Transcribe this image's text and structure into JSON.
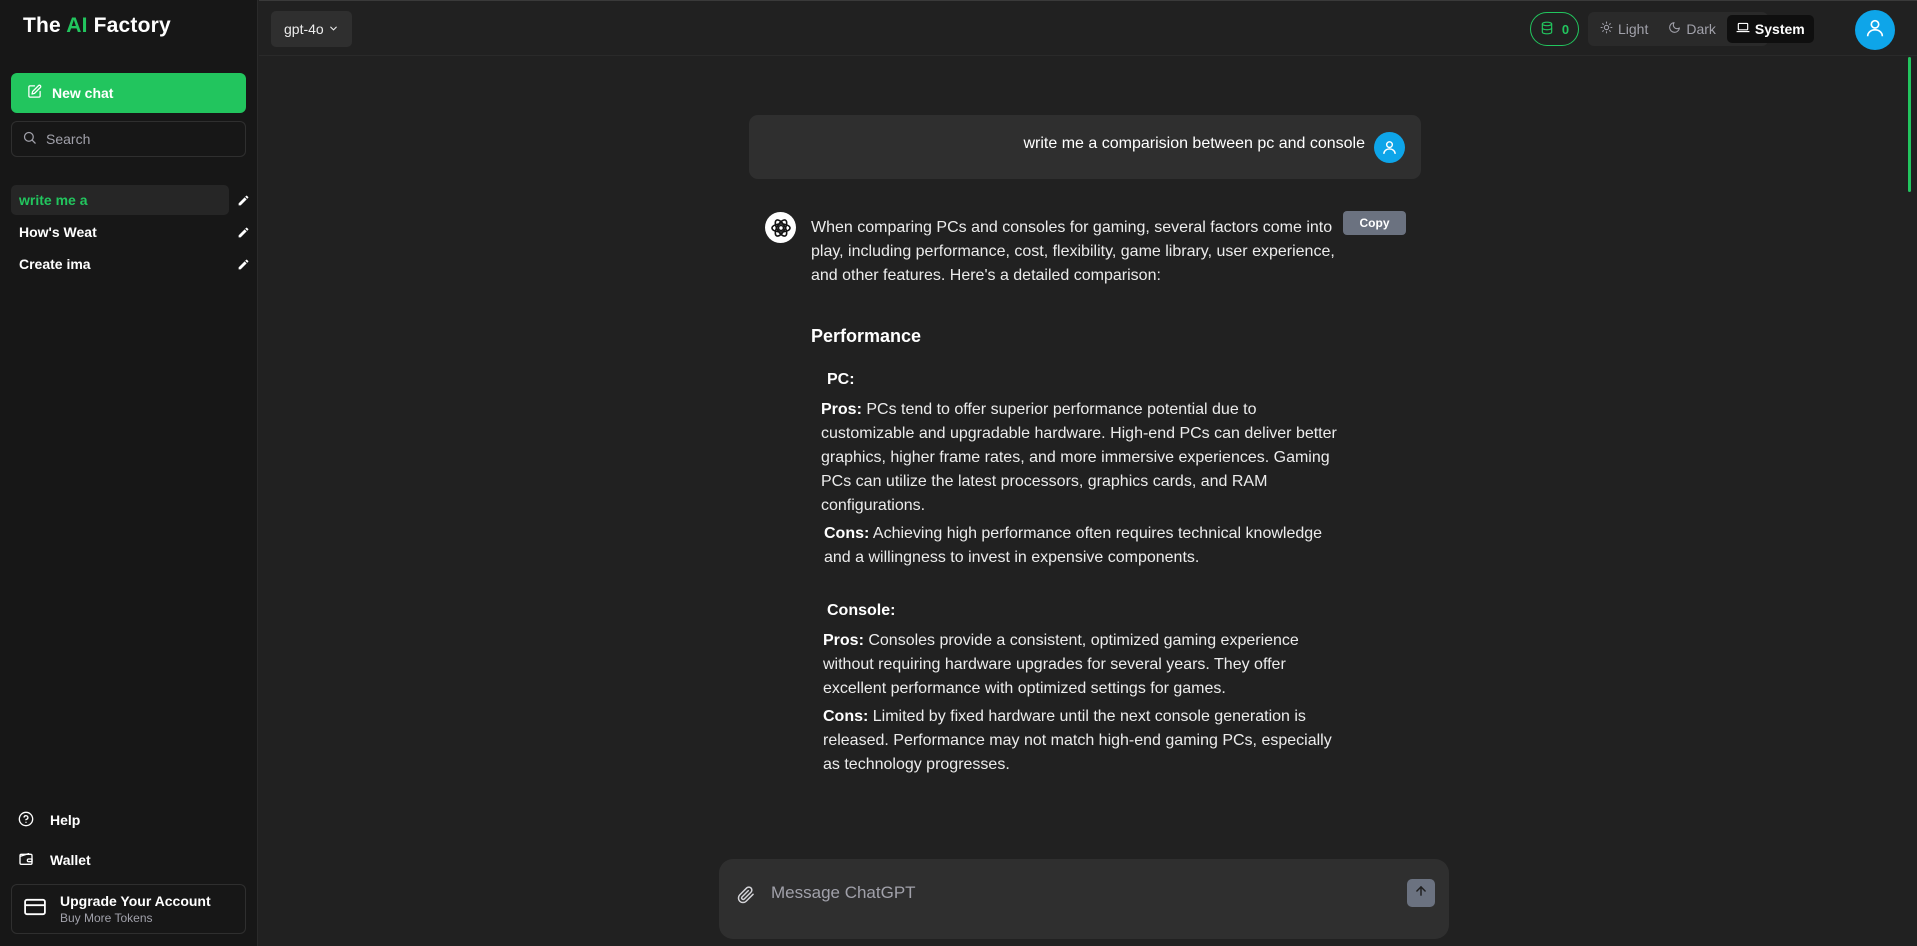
{
  "brand": {
    "prefix": "The ",
    "accent": "AI",
    "suffix": " Factory"
  },
  "sidebar": {
    "new_chat_label": "New chat",
    "search_placeholder": "Search",
    "history": [
      {
        "label": "write me a",
        "active": true
      },
      {
        "label": "How's Weat",
        "active": false
      },
      {
        "label": "Create ima",
        "active": false
      }
    ],
    "help_label": "Help",
    "wallet_label": "Wallet",
    "upgrade_title": "Upgrade Your Account",
    "upgrade_subtitle": "Buy More Tokens"
  },
  "topbar": {
    "model_label": "gpt-4o",
    "token_count": "0",
    "themes": [
      {
        "label": "Light",
        "icon": "sun-icon",
        "active": false
      },
      {
        "label": "Dark",
        "icon": "moon-icon",
        "active": false
      },
      {
        "label": "System",
        "icon": "laptop-icon",
        "active": true
      }
    ]
  },
  "conversation": {
    "user_message": "write me a comparision between pc and console",
    "copy_label": "Copy",
    "intro": "When comparing PCs and consoles for gaming, several factors come into play, including performance, cost, flexibility, game library, user experience, and other features. Here's a detailed comparison:",
    "section_title": "Performance",
    "pc": {
      "heading": "PC:",
      "pros_label": "Pros:",
      "pros_text": " PCs tend to offer superior performance potential due to customizable and upgradable hardware. High-end PCs can deliver better graphics, higher frame rates, and more immersive experiences. Gaming PCs can utilize the latest processors, graphics cards, and RAM configurations.",
      "cons_label": "Cons:",
      "cons_text": " Achieving high performance often requires technical knowledge and a willingness to invest in expensive components."
    },
    "console": {
      "heading": "Console:",
      "pros_label": "Pros:",
      "pros_text": " Consoles provide a consistent, optimized gaming experience without requiring hardware upgrades for several years. They offer excellent performance with optimized settings for games.",
      "cons_label": "Cons:",
      "cons_text": " Limited by fixed hardware until the next console generation is released. Performance may not match high-end gaming PCs, especially as technology progresses."
    }
  },
  "composer": {
    "placeholder": "Message ChatGPT"
  },
  "colors": {
    "accent": "#22c55e",
    "avatar": "#0ea5e9",
    "background": "#212121",
    "sidebar": "#171717"
  }
}
